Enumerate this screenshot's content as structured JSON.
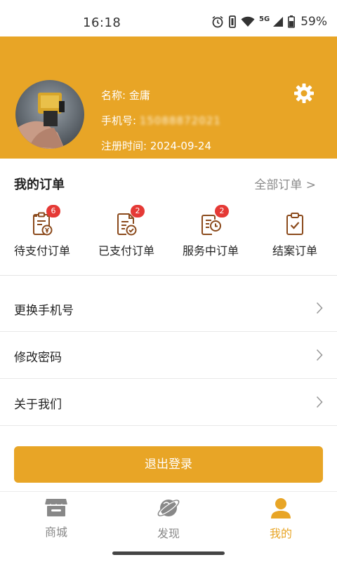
{
  "status_bar": {
    "time": "16:18",
    "network": "5G",
    "battery": "59%",
    "icons": [
      "alarm-icon",
      "vibrate-icon",
      "wifi-icon",
      "signal-icon",
      "battery-icon"
    ]
  },
  "profile": {
    "name_label": "名称:",
    "name": "金庸",
    "phone_label": "手机号:",
    "phone_masked": "15088872021",
    "register_label": "注册时间:",
    "register_date": "2024-09-24",
    "settings_icon": "gear-icon"
  },
  "orders": {
    "title": "我的订单",
    "all_link": "全部订单 >",
    "items": [
      {
        "label": "待支付订单",
        "badge": "6",
        "icon": "pending-payment-icon"
      },
      {
        "label": "已支付订单",
        "badge": "2",
        "icon": "paid-icon"
      },
      {
        "label": "服务中订单",
        "badge": "2",
        "icon": "in-service-icon"
      },
      {
        "label": "结案订单",
        "badge": "",
        "icon": "closed-case-icon"
      }
    ]
  },
  "menu": {
    "items": [
      {
        "label": "更换手机号"
      },
      {
        "label": "修改密码"
      },
      {
        "label": "关于我们"
      }
    ]
  },
  "logout_label": "退出登录",
  "tabs": [
    {
      "label": "商城",
      "icon": "store-icon",
      "active": false
    },
    {
      "label": "发现",
      "icon": "discover-planet-icon",
      "active": false
    },
    {
      "label": "我的",
      "icon": "user-icon",
      "active": true
    }
  ],
  "colors": {
    "accent": "#E8A526",
    "badge": "#E53935",
    "icon_brown": "#8B4A1C"
  }
}
